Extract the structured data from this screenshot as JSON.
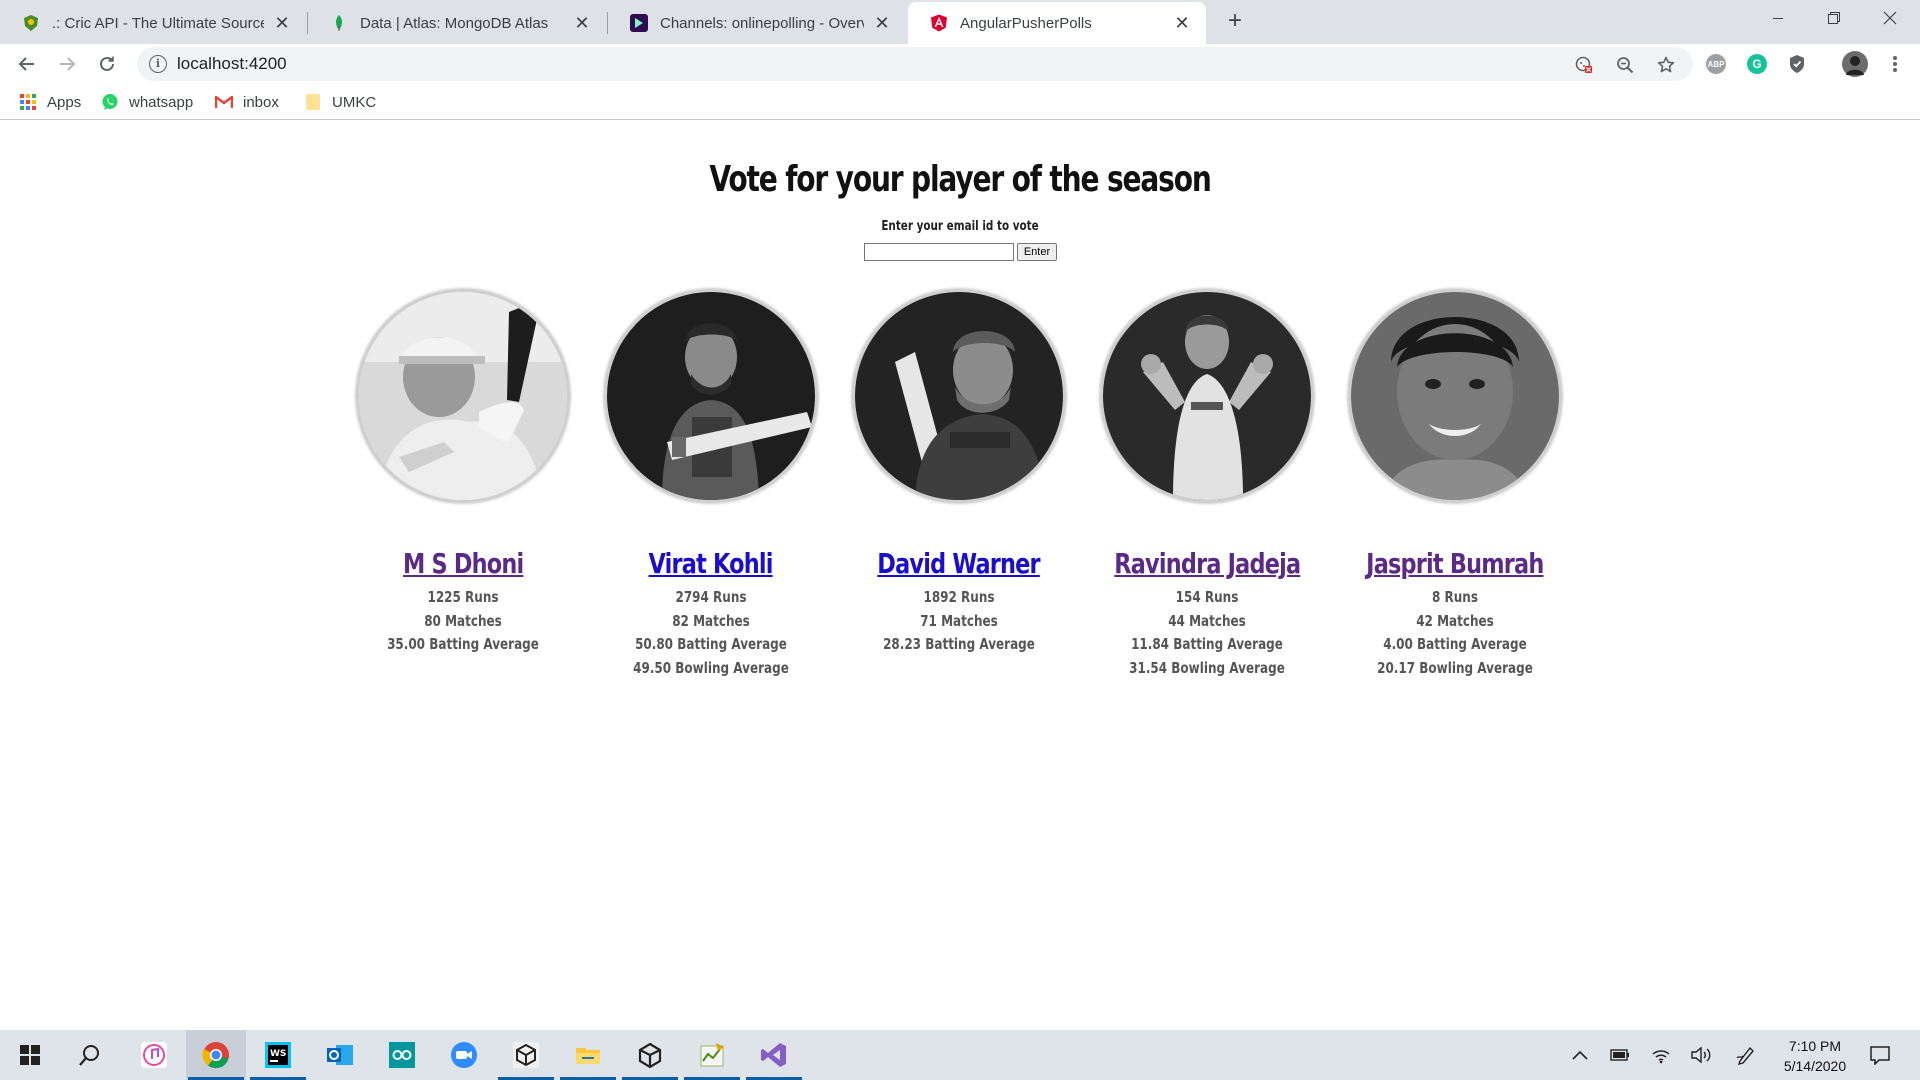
{
  "browser": {
    "tabs": [
      {
        "title": ".: Cric API - The Ultimate Source f",
        "active": false
      },
      {
        "title": "Data | Atlas: MongoDB Atlas",
        "active": false
      },
      {
        "title": "Channels: onlinepolling - Overvie",
        "active": false
      },
      {
        "title": "AngularPusherPolls",
        "active": true
      }
    ],
    "url": "localhost:4200",
    "bookmarks": [
      {
        "label": "Apps",
        "icon": "apps-grid-icon"
      },
      {
        "label": "whatsapp",
        "icon": "whatsapp-icon"
      },
      {
        "label": "inbox",
        "icon": "gmail-icon"
      },
      {
        "label": "UMKC",
        "icon": "folder-icon"
      }
    ],
    "extensions": [
      "ABP",
      "G"
    ]
  },
  "page": {
    "title": "Vote for your player of the season",
    "email_label": "Enter your email id to vote",
    "email_value": "",
    "enter_label": "Enter"
  },
  "players": [
    {
      "name": "M S Dhoni",
      "link_state": "visited",
      "stats": [
        "1225 Runs",
        "80 Matches",
        "35.00 Batting Average"
      ]
    },
    {
      "name": "Virat Kohli",
      "link_state": "link",
      "stats": [
        "2794 Runs",
        "82 Matches",
        "50.80 Batting Average",
        "49.50 Bowling Average"
      ]
    },
    {
      "name": "David Warner",
      "link_state": "link",
      "stats": [
        "1892 Runs",
        "71 Matches",
        "28.23 Batting Average"
      ]
    },
    {
      "name": "Ravindra Jadeja",
      "link_state": "visited",
      "stats": [
        "154 Runs",
        "44 Matches",
        "11.84 Batting Average",
        "31.54 Bowling Average"
      ]
    },
    {
      "name": "Jasprit Bumrah",
      "link_state": "visited",
      "stats": [
        "8 Runs",
        "42 Matches",
        "4.00 Batting Average",
        "20.17 Bowling Average"
      ]
    }
  ],
  "taskbar": {
    "time": "7:10 PM",
    "date": "5/14/2020"
  },
  "colors": {
    "link": "#1a0dcc",
    "visited": "#5b2a86",
    "stat_text": "#555555",
    "taskbar_bg": "#dfe3ea"
  }
}
